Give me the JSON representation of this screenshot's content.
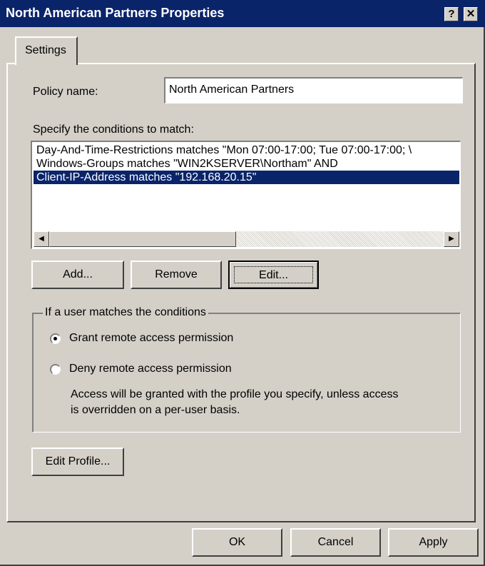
{
  "window": {
    "title": "North American Partners Properties",
    "help_glyph": "?",
    "close_glyph": "✕"
  },
  "tabs": [
    {
      "label": "Settings"
    }
  ],
  "policy": {
    "label": "Policy name:",
    "value": "North American Partners"
  },
  "conditions": {
    "label": "Specify the conditions to match:",
    "items": [
      "Day-And-Time-Restrictions matches \"Mon 07:00-17:00; Tue 07:00-17:00; \\",
      "Windows-Groups matches \"WIN2KSERVER\\Northam\" AND",
      "Client-IP-Address matches \"192.168.20.15\""
    ],
    "selected_index": 2
  },
  "buttons": {
    "add": "Add...",
    "remove": "Remove",
    "edit": "Edit...",
    "edit_profile": "Edit Profile...",
    "ok": "OK",
    "cancel": "Cancel",
    "apply": "Apply"
  },
  "group": {
    "legend": "If a user matches the conditions",
    "grant_label": "Grant remote access permission",
    "deny_label": "Deny remote access permission",
    "selected": "grant",
    "info_line1": "Access will be granted with the profile you specify, unless access",
    "info_line2": "is overridden on a per-user basis."
  },
  "colors": {
    "titlebar": "#0a246a",
    "face": "#d4d0c8",
    "selection": "#0a246a"
  }
}
